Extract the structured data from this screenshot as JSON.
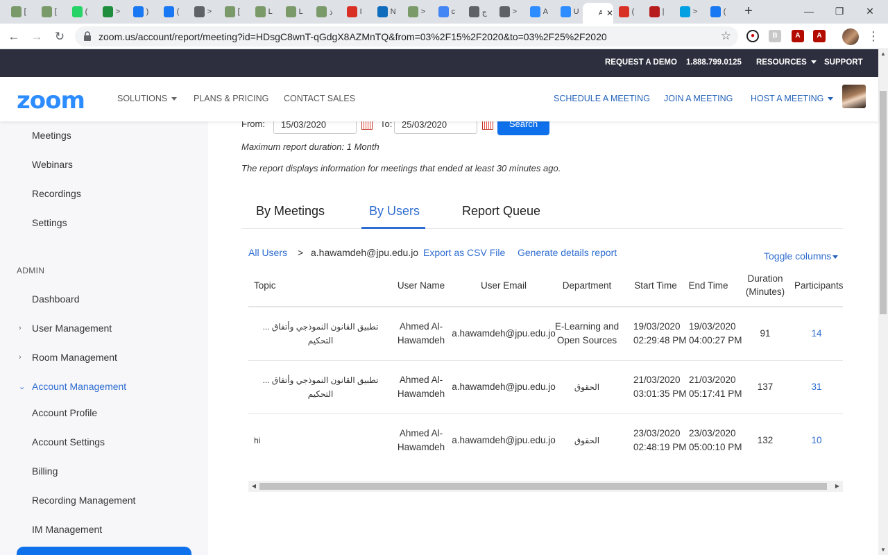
{
  "browser": {
    "tabs": [
      {
        "label": "[",
        "favicon": "page-icon",
        "color": "#7a9a6a"
      },
      {
        "label": "[",
        "favicon": "page-icon",
        "color": "#7a9a6a"
      },
      {
        "label": "(",
        "favicon": "whatsapp-icon",
        "color": "#25d366"
      },
      {
        "label": ">",
        "favicon": "plus-icon",
        "color": "#1e8e3e"
      },
      {
        "label": ")",
        "favicon": "facebook-icon",
        "color": "#1877f2"
      },
      {
        "label": "(",
        "favicon": "facebook-icon",
        "color": "#1877f2"
      },
      {
        "label": ">",
        "favicon": "globe-icon",
        "color": "#5f6368"
      },
      {
        "label": "[",
        "favicon": "page-icon",
        "color": "#7a9a6a"
      },
      {
        "label": "L",
        "favicon": "page-icon",
        "color": "#7a9a6a"
      },
      {
        "label": "L",
        "favicon": "page-icon",
        "color": "#7a9a6a"
      },
      {
        "label": "ﺫ",
        "favicon": "page-icon",
        "color": "#7a9a6a"
      },
      {
        "label": "I",
        "favicon": "gmail-icon",
        "color": "#d93025"
      },
      {
        "label": "N",
        "favicon": "outlook-icon",
        "color": "#0f6cbd"
      },
      {
        "label": ">",
        "favicon": "page-icon",
        "color": "#7a9a6a"
      },
      {
        "label": "c",
        "favicon": "google-icon",
        "color": "#4285f4"
      },
      {
        "label": "ﺝ",
        "favicon": "globe-icon",
        "color": "#5f6368"
      },
      {
        "label": ">",
        "favicon": "globe-icon",
        "color": "#5f6368"
      },
      {
        "label": "A",
        "favicon": "zoom-icon",
        "color": "#2d8cff"
      },
      {
        "label": "U",
        "favicon": "zoom-icon",
        "color": "#2d8cff"
      },
      {
        "label": "A",
        "favicon": "page-icon",
        "color": "#ffffff",
        "active": true
      },
      {
        "label": "(",
        "favicon": "gmail-icon",
        "color": "#d93025"
      },
      {
        "label": "|",
        "favicon": "tl-icon",
        "color": "#b71c1c"
      },
      {
        "label": ">",
        "favicon": "site-icon",
        "color": "#00a0e3"
      },
      {
        "label": "(",
        "favicon": "facebook-icon",
        "color": "#1877f2"
      }
    ],
    "url": "zoom.us/account/report/meeting?id=HDsgC8wnT-qGdgX8AZMnTQ&from=03%2F15%2F2020&to=03%2F25%2F2020"
  },
  "topbar": {
    "request_demo": "REQUEST A DEMO",
    "phone": "1.888.799.0125",
    "resources": "RESOURCES",
    "support": "SUPPORT"
  },
  "nav": {
    "logo": "zoom",
    "solutions": "SOLUTIONS",
    "plans": "PLANS & PRICING",
    "contact": "CONTACT SALES",
    "schedule": "SCHEDULE A MEETING",
    "join": "JOIN A MEETING",
    "host": "HOST A MEETING"
  },
  "sidebar": {
    "meetings": "Meetings",
    "webinars": "Webinars",
    "recordings": "Recordings",
    "settings": "Settings",
    "admin_heading": "ADMIN",
    "dashboard": "Dashboard",
    "user_management": "User Management",
    "room_management": "Room Management",
    "account_management": "Account Management",
    "account_profile": "Account Profile",
    "account_settings": "Account Settings",
    "billing": "Billing",
    "recording_management": "Recording Management",
    "im_management": "IM Management"
  },
  "filters": {
    "from_label": "From:",
    "from_value": "15/03/2020",
    "to_label": "To:",
    "to_value": "25/03/2020",
    "search_label": "Search",
    "note_duration": "Maximum report duration: 1 Month",
    "note_info": "The report displays information for meetings that ended at least 30 minutes ago."
  },
  "report_tabs": {
    "by_meetings": "By Meetings",
    "by_users": "By Users",
    "report_queue": "Report Queue"
  },
  "breadcrumb": {
    "all_users": "All Users",
    "separator": ">",
    "user": "a.hawamdeh@jpu.edu.jo",
    "export_csv": "Export as CSV File",
    "generate": "Generate details report",
    "toggle_columns": "Toggle columns"
  },
  "table": {
    "headers": {
      "topic": "Topic",
      "user_name": "User Name",
      "user_email": "User Email",
      "department": "Department",
      "start_time": "Start Time",
      "end_time": "End Time",
      "duration": "Duration (Minutes)",
      "participants": "Participants"
    },
    "rows": [
      {
        "topic": "... تطبيق القانون النموذجي وأتفاق التحكيم",
        "user_name": "Ahmed Al-Hawamdeh",
        "user_email": "a.hawamdeh@jpu.edu.jo",
        "department": "E-Learning and Open Sources",
        "start_time": "19/03/2020 02:29:48 PM",
        "end_time": "19/03/2020 04:00:27 PM",
        "duration": "91",
        "participants": "14"
      },
      {
        "topic": "... تطبيق القانون النموذجي وأتفاق التحكيم",
        "user_name": "Ahmed Al-Hawamdeh",
        "user_email": "a.hawamdeh@jpu.edu.jo",
        "department": "الحقوق",
        "start_time": "21/03/2020 03:01:35 PM",
        "end_time": "21/03/2020 05:17:41 PM",
        "duration": "137",
        "participants": "31"
      },
      {
        "topic": "hi",
        "user_name": "Ahmed Al-Hawamdeh",
        "user_email": "a.hawamdeh@jpu.edu.jo",
        "department": "الحقوق",
        "start_time": "23/03/2020 02:48:19 PM",
        "end_time": "23/03/2020 05:00:10 PM",
        "duration": "132",
        "participants": "10"
      }
    ]
  }
}
